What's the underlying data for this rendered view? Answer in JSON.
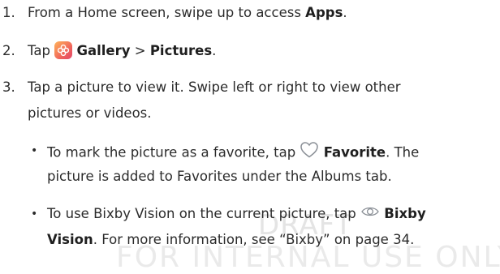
{
  "watermark": {
    "line1": "DRAFT",
    "line2": "FOR INTERNAL USE ONLY"
  },
  "steps": [
    {
      "number": "1.",
      "text_before": "From a Home screen, swipe up to access ",
      "bold": "Apps",
      "text_after": "."
    },
    {
      "number": "2.",
      "text_before": "Tap ",
      "icon": "gallery-app-icon",
      "bold1": "Gallery",
      "separator": ">",
      "bold2": "Pictures",
      "text_after": "."
    },
    {
      "number": "3.",
      "line1": "Tap a picture to view it. Swipe left or right to view other",
      "line2": "pictures or videos."
    }
  ],
  "bullets": [
    {
      "marker": "•",
      "line1_before": "To mark the picture as a favorite, tap ",
      "icon": "heart-icon",
      "bold": "Favorite",
      "line1_after": ". The",
      "line2": "picture is added to Favorites under the Albums tab."
    },
    {
      "marker": "•",
      "line1_before": "To use Bixby Vision on the current picture, tap ",
      "icon": "bixby-vision-icon",
      "bold_line1": "Bixby",
      "bold_line2": "Vision",
      "line2_mid": ". For more information, see ",
      "link": "“Bixby” on page 34",
      "line2_after": "."
    }
  ],
  "colors": {
    "text": "#2b2b2b",
    "watermark": "#e4e4e4",
    "heart_outline": "#8a8f96"
  }
}
